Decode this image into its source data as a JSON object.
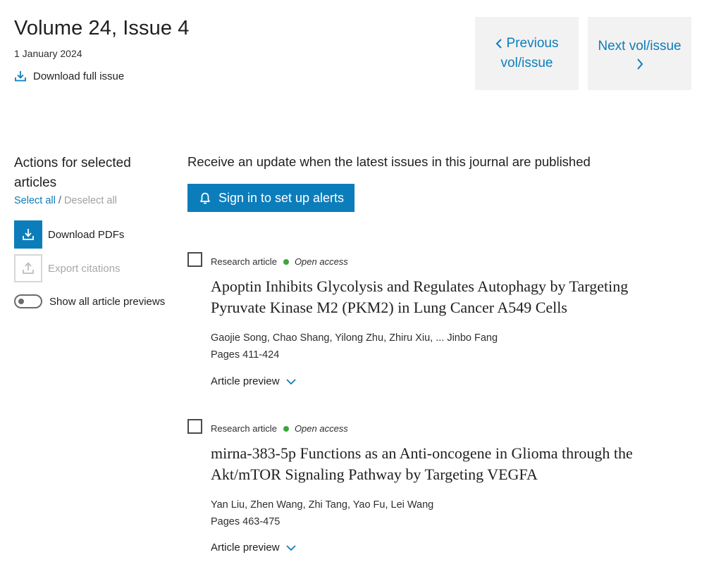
{
  "header": {
    "title": "Volume 24, Issue 4",
    "date": "1 January 2024",
    "download_full": "Download full issue"
  },
  "nav": {
    "prev_line1": "Previous",
    "prev_line2": "vol/issue",
    "next_line1": "Next vol/issue"
  },
  "actions": {
    "heading_line1": "Actions for selected",
    "heading_line2": "articles",
    "select_all": "Select all",
    "separator": "/",
    "deselect_all": "Deselect all",
    "download_pdfs": "Download PDFs",
    "export_citations": "Export citations",
    "show_previews": "Show all article previews"
  },
  "alerts": {
    "text": "Receive an update when the latest issues in this journal are published",
    "button": "Sign in to set up alerts"
  },
  "articles": [
    {
      "type": "Research article",
      "access": "Open access",
      "title_line1": "Apoptin Inhibits Glycolysis and Regulates Autophagy by Targeting",
      "title_line2": "Pyruvate Kinase M2 (PKM2) in Lung Cancer A549 Cells",
      "authors": "Gaojie Song, Chao Shang, Yilong Zhu, Zhiru Xiu, ... Jinbo Fang",
      "pages": "Pages 411-424",
      "preview": "Article preview"
    },
    {
      "type": "Research article",
      "access": "Open access",
      "title_line1": "mirna-383-5p Functions as an Anti-oncogene in Glioma through the",
      "title_line2": "Akt/mTOR Signaling Pathway by Targeting VEGFA",
      "authors": "Yan Liu, Zhen Wang, Zhi Tang, Yao Fu, Lei Wang",
      "pages": "Pages 463-475",
      "preview": "Article preview"
    }
  ],
  "colors": {
    "accent": "#0c7dbb",
    "open_access_dot": "#3aa63a",
    "nav_bg": "#f2f2f2"
  }
}
